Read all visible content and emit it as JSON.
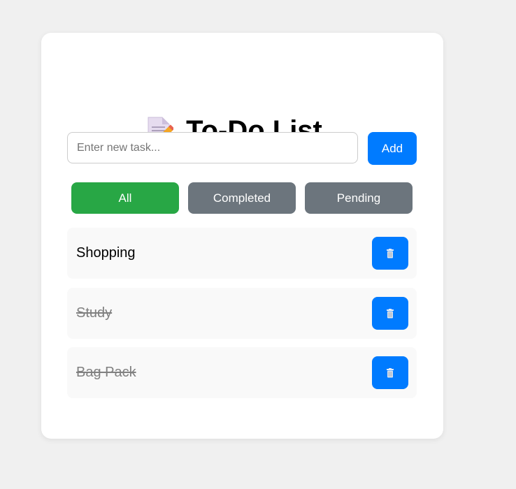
{
  "header": {
    "title": "To-Do List",
    "icon": "memo-icon"
  },
  "new_task": {
    "placeholder": "Enter new task...",
    "value": "",
    "add_label": "Add"
  },
  "filters": [
    {
      "label": "All",
      "active": true
    },
    {
      "label": "Completed",
      "active": false
    },
    {
      "label": "Pending",
      "active": false
    }
  ],
  "tasks": [
    {
      "text": "Shopping",
      "completed": false,
      "delete_icon": "trash-icon"
    },
    {
      "text": "Study",
      "completed": true,
      "delete_icon": "trash-icon"
    },
    {
      "text": "Bag Pack",
      "completed": true,
      "delete_icon": "trash-icon"
    }
  ],
  "colors": {
    "primary": "#007bff",
    "active_filter": "#28a745",
    "inactive_filter": "#6c757d",
    "background": "#f0f0f0",
    "card": "#ffffff",
    "task_bg": "#f9f9f9",
    "completed_text": "#808080"
  }
}
